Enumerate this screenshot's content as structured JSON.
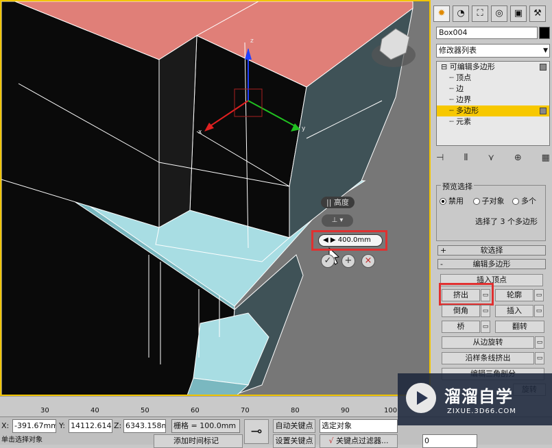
{
  "viewport": {
    "caddy_label": "|| 高度",
    "caddy_dropdown": "⊥ ▾",
    "caddy_value": "◀ ▶  400.0mm",
    "axis_labels": {
      "z": "z",
      "x": "x",
      "y": "y"
    },
    "colors": {
      "roof": "#e07f78",
      "wall": "#0a0a0a",
      "side": "#3f5257",
      "highlight": "#a8dde3",
      "frame": "#f2c500"
    }
  },
  "panel": {
    "tabs": [
      "✹",
      "◔",
      "⛶",
      "◎",
      "▣",
      "⚒"
    ],
    "object_name": "Box004",
    "modifier_list": "修改器列表",
    "stack": {
      "root": "⊟ 可编辑多边形",
      "items": [
        "顶点",
        "边",
        "边界",
        "多边形",
        "元素"
      ],
      "selected_index": 3
    },
    "stack_icons": [
      "⊣",
      "Ⅱ",
      "⋎",
      "⊕",
      "▦"
    ],
    "preview": {
      "title": "预览选择",
      "options": [
        "禁用",
        "子对象",
        "多个"
      ],
      "selected": 0,
      "status": "选择了 3 个多边形"
    },
    "rollouts": {
      "soft": {
        "sign": "+",
        "label": "软选择"
      },
      "edit": {
        "sign": "-",
        "label": "编辑多边形"
      }
    },
    "buttons": {
      "insert_vertex": "插入顶点",
      "extrude": "挤出",
      "outline": "轮廓",
      "bevel": "倒角",
      "inset": "插入",
      "bridge": "桥",
      "flip": "翻转",
      "hinge": "从边旋转",
      "spline": "沿样条线挤出",
      "tri": "编辑三角剖分",
      "rotate": "旋转"
    }
  },
  "timeline": {
    "ticks": [
      "30",
      "40",
      "50",
      "60",
      "70",
      "80",
      "90",
      "100"
    ]
  },
  "status": {
    "x_label": "X:",
    "x_value": "-391.67mm",
    "y_label": "Y:",
    "y_value": "14112.614",
    "z_label": "Z:",
    "z_value": "6343.158m",
    "grid": "栅格 = 100.0mm",
    "auto_key": "自动关键点",
    "set_key": "设置关键点",
    "selected_object": "选定对象",
    "key_filters": "关键点过滤器...",
    "add_time_tag": "添加时间标记",
    "prompt": "单击选择对象",
    "frame_value": "0",
    "key_icon": "key-icon"
  },
  "watermark": {
    "title": "溜溜自学",
    "url": "ZIXUE.3D66.COM"
  }
}
